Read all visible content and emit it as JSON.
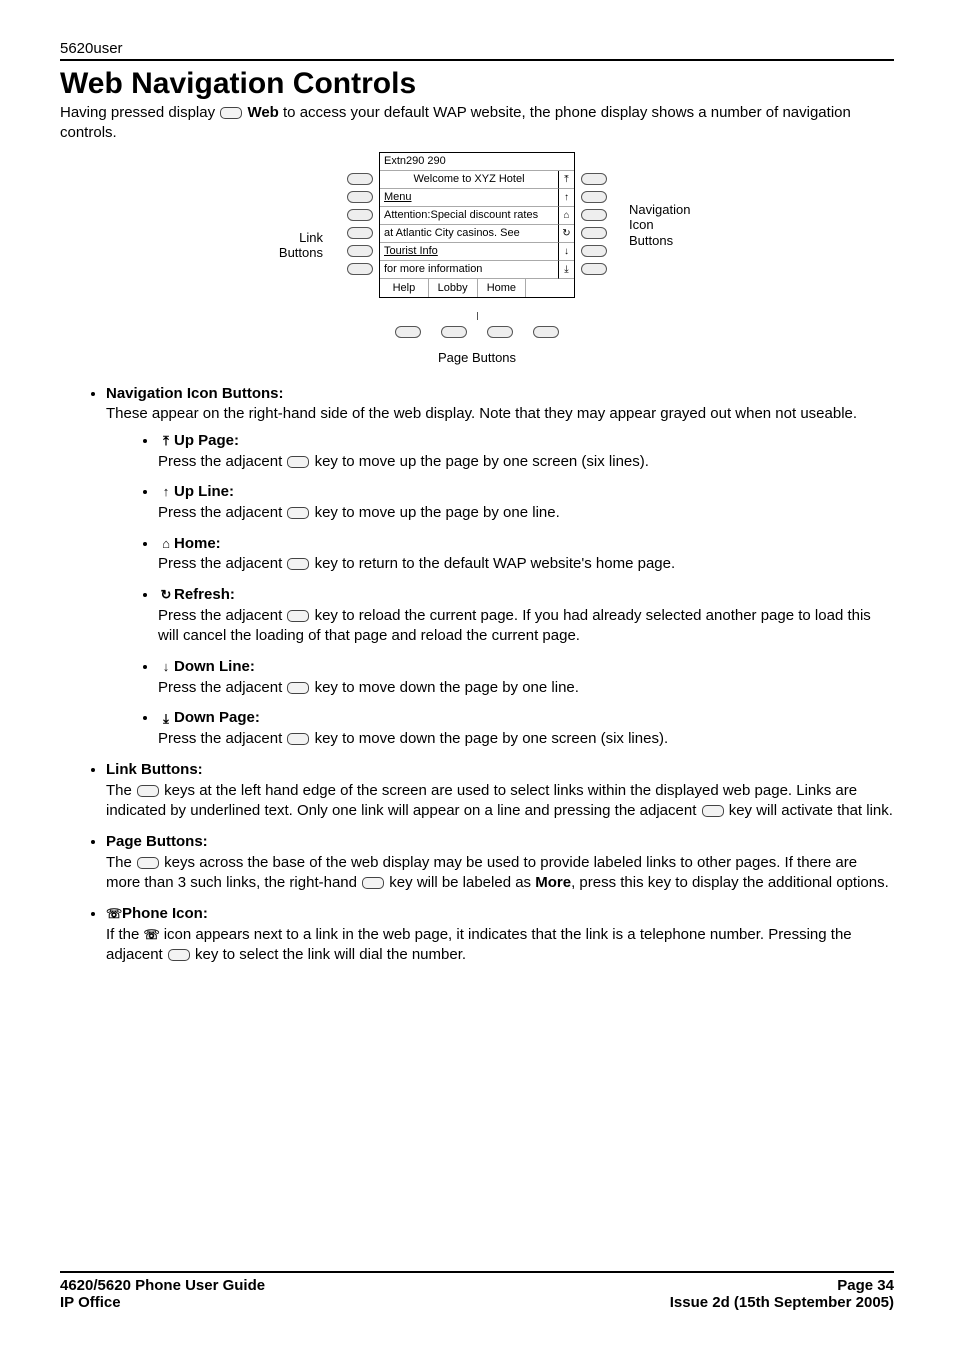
{
  "header": {
    "doc_label": "5620user"
  },
  "title": "Web Navigation Controls",
  "intro": {
    "t1": "Having pressed display ",
    "web": "Web",
    "t2": " to access your default WAP website, the phone display shows a number of navigation controls."
  },
  "figure": {
    "link_label": "Link\nButtons",
    "nav_label": "Navigation\nIcon\nButtons",
    "page_label": "Page Buttons",
    "screen": {
      "title": "Extn290 290",
      "welcome": "Welcome to XYZ Hotel",
      "rows": [
        "Menu",
        "Attention:Special discount rates",
        "at Atlantic City casinos. See",
        "Tourist Info",
        "for more information"
      ],
      "nav_icons": [
        "⤒",
        "↑",
        "⌂",
        "↻",
        "↓",
        "⤓"
      ],
      "bottombar": [
        "Help",
        "Lobby",
        "Home",
        ""
      ]
    }
  },
  "sections": {
    "nav": {
      "label": "Navigation Icon Buttons:",
      "desc": "These appear on the right-hand side of the web display. Note that they may appear grayed out when not useable.",
      "items": [
        {
          "glyph": "⤒",
          "label": "Up Page:",
          "d1": "Press the adjacent ",
          "d2": " key to move up the page by one screen (six lines)."
        },
        {
          "glyph": "↑",
          "label": "Up Line:",
          "d1": "Press the adjacent ",
          "d2": " key to move up the page by one line."
        },
        {
          "glyph": "⌂",
          "label": "Home:",
          "d1": "Press the adjacent ",
          "d2": " key to return to the default WAP website's home page."
        },
        {
          "glyph": "↻",
          "label": "Refresh:",
          "d1": "Press the adjacent ",
          "d2": " key to reload the current page. If you had already selected another page to load this will cancel the loading of that page and reload the current page."
        },
        {
          "glyph": "↓",
          "label": "Down Line:",
          "d1": "Press the adjacent ",
          "d2": " key to move down the page by one line."
        },
        {
          "glyph": "⤓",
          "label": "Down Page:",
          "d1": "Press the adjacent ",
          "d2": " key to move down the page by one screen (six lines)."
        }
      ]
    },
    "link": {
      "label": "Link Buttons:",
      "d1": "The ",
      "d2": " keys at the left hand edge of the screen are used to select links within the displayed web page. Links are indicated by underlined text. Only one link will appear on a line and pressing the adjacent ",
      "d3": " key will activate that link."
    },
    "page": {
      "label": "Page Buttons:",
      "d1": "The ",
      "d2": " keys across the base of the web display may be used to provide labeled links to other pages. If there are more than 3 such links, the right-hand ",
      "d3": " key will be labeled as ",
      "more": "More",
      "d4": ", press this key to display the additional options."
    },
    "phone": {
      "glyph": "☏",
      "label": "Phone Icon:",
      "d1": "If the ",
      "d2": " icon appears next to a link in the web page, it indicates that the link is a telephone number. Pressing the adjacent ",
      "d3": " key to select the link will dial the number."
    }
  },
  "footer": {
    "left1": "4620/5620 Phone User Guide",
    "right1": "Page 34",
    "left2": "IP Office",
    "right2": "Issue 2d (15th September 2005)"
  }
}
